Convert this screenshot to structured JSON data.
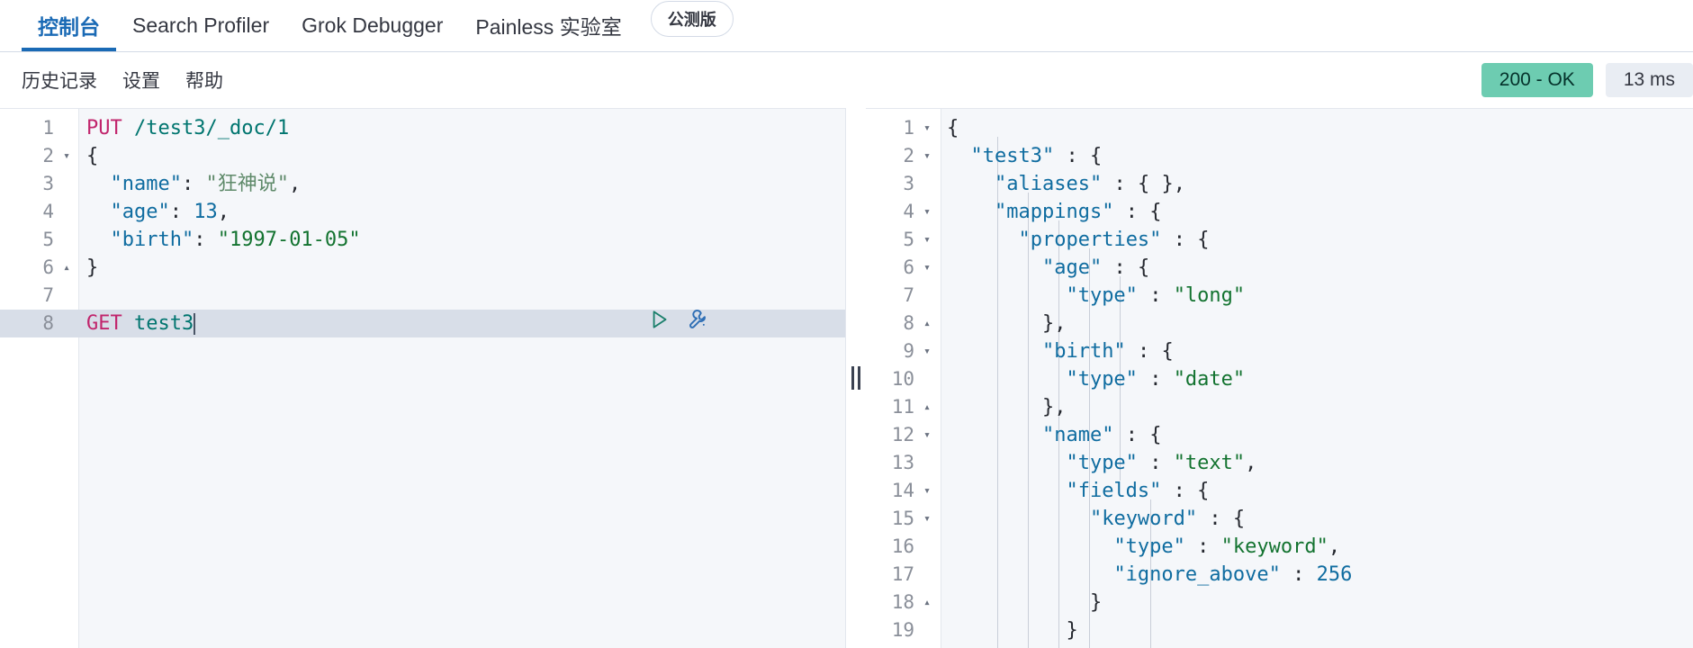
{
  "tabs": [
    {
      "label": "控制台",
      "active": true
    },
    {
      "label": "Search Profiler",
      "active": false
    },
    {
      "label": "Grok Debugger",
      "active": false
    },
    {
      "label": "Painless 实验室",
      "active": false
    }
  ],
  "beta_badge": "公测版",
  "toolbar": {
    "history_label": "历史记录",
    "settings_label": "设置",
    "help_label": "帮助"
  },
  "status": {
    "code_label": "200 - OK",
    "time_label": "13 ms",
    "ok_color": "#6dccb1",
    "time_color": "#e9edf3"
  },
  "request_editor": {
    "lines": [
      {
        "num": "1",
        "fold": "",
        "text": "PUT /test3/_doc/1"
      },
      {
        "num": "2",
        "fold": "▾",
        "text": "{"
      },
      {
        "num": "3",
        "fold": "",
        "text": "  \"name\": \"狂神说\","
      },
      {
        "num": "4",
        "fold": "",
        "text": "  \"age\": 13,"
      },
      {
        "num": "5",
        "fold": "",
        "text": "  \"birth\": \"1997-01-05\""
      },
      {
        "num": "6",
        "fold": "▴",
        "text": "}"
      },
      {
        "num": "7",
        "fold": "",
        "text": ""
      },
      {
        "num": "8",
        "fold": "",
        "text": "GET test3"
      }
    ],
    "active_line_number": "8",
    "play_icon": "play-icon",
    "wrench_icon": "wrench-icon"
  },
  "response_editor": {
    "lines": [
      {
        "num": "1",
        "fold": "▾",
        "text": "{"
      },
      {
        "num": "2",
        "fold": "▾",
        "text": "  \"test3\" : {"
      },
      {
        "num": "3",
        "fold": "",
        "text": "    \"aliases\" : { },"
      },
      {
        "num": "4",
        "fold": "▾",
        "text": "    \"mappings\" : {"
      },
      {
        "num": "5",
        "fold": "▾",
        "text": "      \"properties\" : {"
      },
      {
        "num": "6",
        "fold": "▾",
        "text": "        \"age\" : {"
      },
      {
        "num": "7",
        "fold": "",
        "text": "          \"type\" : \"long\""
      },
      {
        "num": "8",
        "fold": "▴",
        "text": "        },"
      },
      {
        "num": "9",
        "fold": "▾",
        "text": "        \"birth\" : {"
      },
      {
        "num": "10",
        "fold": "",
        "text": "          \"type\" : \"date\""
      },
      {
        "num": "11",
        "fold": "▴",
        "text": "        },"
      },
      {
        "num": "12",
        "fold": "▾",
        "text": "        \"name\" : {"
      },
      {
        "num": "13",
        "fold": "",
        "text": "          \"type\" : \"text\","
      },
      {
        "num": "14",
        "fold": "▾",
        "text": "          \"fields\" : {"
      },
      {
        "num": "15",
        "fold": "▾",
        "text": "            \"keyword\" : {"
      },
      {
        "num": "16",
        "fold": "",
        "text": "              \"type\" : \"keyword\","
      },
      {
        "num": "17",
        "fold": "",
        "text": "              \"ignore_above\" : 256"
      },
      {
        "num": "18",
        "fold": "▴",
        "text": "            }"
      },
      {
        "num": "19",
        "fold": "",
        "text": "          }"
      }
    ]
  },
  "splitter": {
    "name": "pane-splitter"
  }
}
